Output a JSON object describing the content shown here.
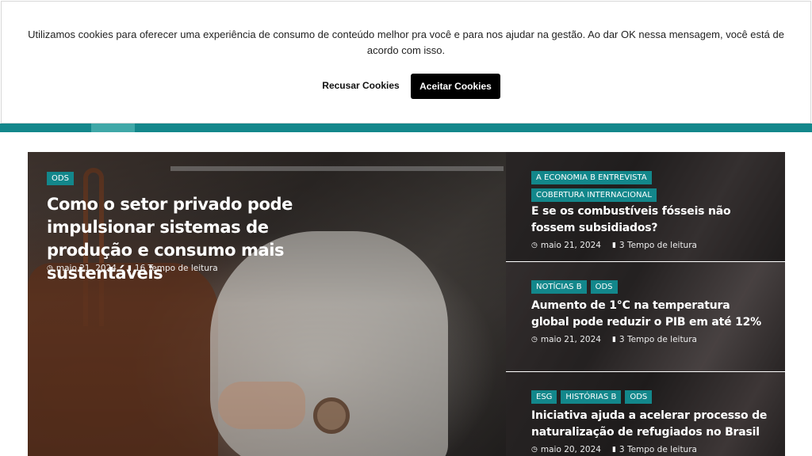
{
  "cookie": {
    "message": "Utilizamos cookies para oferecer uma experiência de consumo de conteúdo melhor pra você e para nos ajudar na gestão. Ao dar OK nessa mensagem, você está de acordo com isso.",
    "refuse_label": "Recusar Cookies",
    "accept_label": "Aceitar Cookies"
  },
  "colors": {
    "accent": "#13878b",
    "accent_active": "#3fa8a8",
    "tag_bg": "#13878b"
  },
  "featured": {
    "tags": [
      "ODS"
    ],
    "title": "Como o setor privado pode impulsionar sistemas de produção e consumo mais sustentáveis",
    "date": "maio 21, 2024",
    "read_time": "16 Tempo de leitura"
  },
  "side_articles": [
    {
      "tags": [
        "A ECONOMIA B ENTREVISTA",
        "COBERTURA INTERNACIONAL"
      ],
      "title": "E se os combustíveis fósseis não fossem subsidiados?",
      "date": "maio 21, 2024",
      "read_time": "3 Tempo de leitura"
    },
    {
      "tags": [
        "NOTÍCIAS B",
        "ODS"
      ],
      "title": "Aumento de 1°C na temperatura global pode reduzir o PIB em até 12%",
      "date": "maio 21, 2024",
      "read_time": "3 Tempo de leitura"
    },
    {
      "tags": [
        "ESG",
        "HISTÓRIAS B",
        "ODS"
      ],
      "title": "Iniciativa ajuda a acelerar processo de naturalização de refugiados no Brasil",
      "date": "maio 20, 2024",
      "read_time": "3 Tempo de leitura"
    }
  ],
  "icons": {
    "date": "clock-icon",
    "read_time": "book-icon"
  }
}
